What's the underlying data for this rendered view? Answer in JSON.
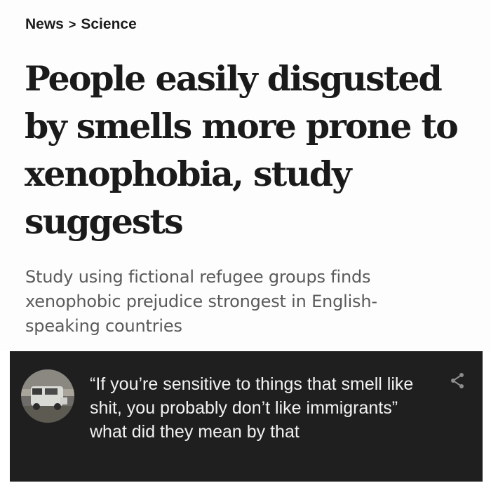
{
  "breadcrumb": {
    "section": "News",
    "separator": ">",
    "subsection": "Science"
  },
  "article": {
    "headline": "People easily disgusted by smells more prone to xenophobia, study suggests",
    "standfirst": "Study using fictional refugee groups finds xenophobic prejudice strongest in English-speaking countries"
  },
  "comment": {
    "text": "“If you’re sensitive to things that smell like shit, you probably don’t like immigrants” what did they mean by that",
    "share_icon": "share-icon"
  },
  "colors": {
    "comment_background": "#1f1f1f",
    "comment_text": "#f2f2f2",
    "headline": "#1a1a1a",
    "standfirst": "#5a5a5a"
  }
}
